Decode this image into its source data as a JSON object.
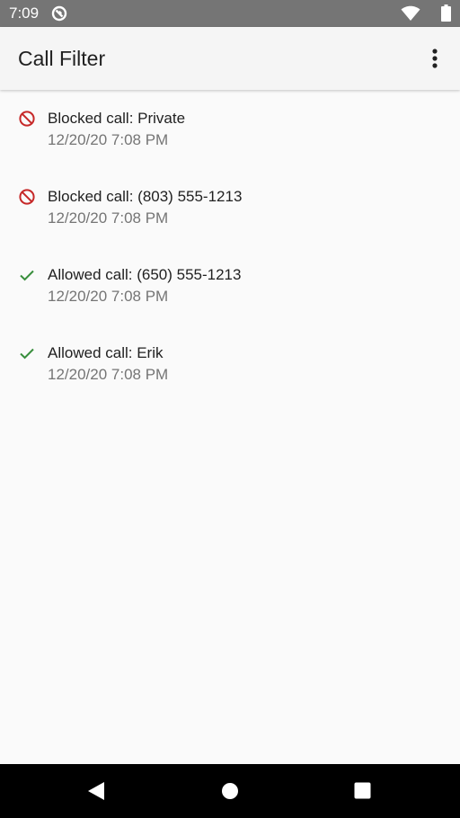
{
  "status_bar": {
    "time": "7:09",
    "icons": [
      "app-notification-icon",
      "wifi-icon",
      "battery-icon"
    ]
  },
  "app_bar": {
    "title": "Call Filter",
    "overflow_icon": "more-vert-icon"
  },
  "calls": [
    {
      "status": "blocked",
      "icon": "block-icon",
      "label": "Blocked call: Private",
      "time": "12/20/20 7:08 PM"
    },
    {
      "status": "blocked",
      "icon": "block-icon",
      "label": "Blocked call: (803) 555-1213",
      "time": "12/20/20 7:08 PM"
    },
    {
      "status": "allowed",
      "icon": "check-icon",
      "label": "Allowed call: (650) 555-1213",
      "time": "12/20/20 7:08 PM"
    },
    {
      "status": "allowed",
      "icon": "check-icon",
      "label": "Allowed call: Erik",
      "time": "12/20/20 7:08 PM"
    }
  ],
  "nav_bar": {
    "icons": [
      "back-icon",
      "home-icon",
      "recents-icon"
    ]
  },
  "colors": {
    "status_bar": "#757575",
    "app_bar": "#f5f5f5",
    "background": "#fafafa",
    "blocked": "#c62828",
    "allowed": "#388e3c",
    "secondary_text": "#757575"
  }
}
